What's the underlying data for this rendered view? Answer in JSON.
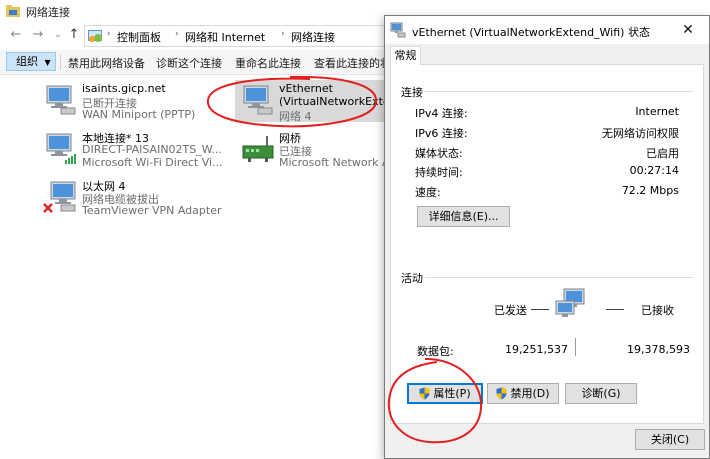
{
  "explorer": {
    "title": "网络连接",
    "breadcrumb": [
      "控制面板",
      "网络和 Internet",
      "网络连接"
    ],
    "toolbar": {
      "organize": "组织",
      "disable": "禁用此网络设备",
      "diagnose": "诊断这个连接",
      "rename": "重命名此连接",
      "view_status": "查看此连接的状态"
    },
    "connections": [
      {
        "name": "isaints.gicp.net",
        "status": "已断开连接",
        "device": "WAN Miniport (PPTP)"
      },
      {
        "name": "本地连接* 13",
        "status": "DIRECT-PAISAIN02TS_W...",
        "device": "Microsoft Wi-Fi Direct Vi..."
      },
      {
        "name": "以太网 4",
        "status": "网络电缆被拔出",
        "device": "TeamViewer VPN Adapter"
      },
      {
        "name": "vEthernet",
        "status": "(VirtualNetworkExtend_...",
        "device": "网络 4"
      },
      {
        "name": "网桥",
        "status": "已连接",
        "device": "Microsoft Network Ada..."
      }
    ]
  },
  "dialog": {
    "title": "vEthernet (VirtualNetworkExtend_Wifi) 状态",
    "close_glyph": "✕",
    "tab": "常规",
    "connection": {
      "heading": "连接",
      "rows": [
        {
          "label": "IPv4 连接:",
          "value": "Internet"
        },
        {
          "label": "IPv6 连接:",
          "value": "无网络访问权限"
        },
        {
          "label": "媒体状态:",
          "value": "已启用"
        },
        {
          "label": "持续时间:",
          "value": "00:27:14"
        },
        {
          "label": "速度:",
          "value": "72.2 Mbps"
        }
      ],
      "details_button": "详细信息(E)..."
    },
    "activity": {
      "heading": "活动",
      "sent_label": "已发送",
      "received_label": "已接收",
      "packets_label": "数据包:",
      "packets_sent": "19,251,537",
      "packets_received": "19,378,593"
    },
    "buttons": {
      "properties": "属性(P)",
      "disable": "禁用(D)",
      "diagnose": "诊断(G)",
      "close": "关闭(C)"
    }
  }
}
